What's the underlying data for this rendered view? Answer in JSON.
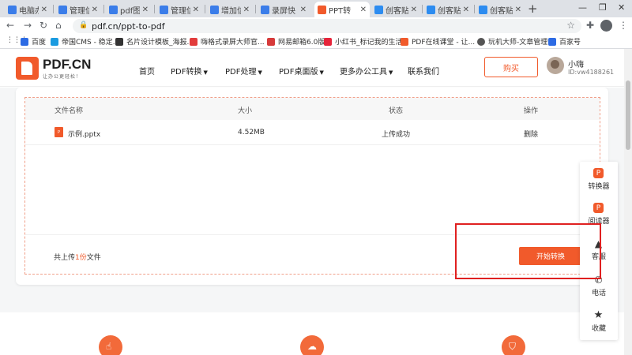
{
  "browser": {
    "tabs": [
      {
        "title": "电脑办公",
        "favicon_color": "#3b7de9",
        "active": false
      },
      {
        "title": "管理信息",
        "favicon_color": "#3b7de9",
        "active": false
      },
      {
        "title": "pdf图片",
        "favicon_color": "#3b7de9",
        "active": false
      },
      {
        "title": "管理信息",
        "favicon_color": "#3b7de9",
        "active": false
      },
      {
        "title": "增加信息",
        "favicon_color": "#3b7de9",
        "active": false
      },
      {
        "title": "录屏快",
        "favicon_color": "#3b7de9",
        "active": false
      },
      {
        "title": "PPT转",
        "favicon_color": "#f15a2b",
        "active": true
      },
      {
        "title": "创客贴",
        "favicon_color": "#2d8cf0",
        "active": false
      },
      {
        "title": "创客贴",
        "favicon_color": "#2d8cf0",
        "active": false
      },
      {
        "title": "创客贴",
        "favicon_color": "#2d8cf0",
        "active": false
      }
    ],
    "url": "pdf.cn/ppt-to-pdf",
    "bookmarks": [
      {
        "label": "百度",
        "color": "#2d6be4"
      },
      {
        "label": "帝国CMS - 稳定...",
        "color": "#1b9be0"
      },
      {
        "label": "名片设计模板_海报...",
        "color": "#333333"
      },
      {
        "label": "嗨格式录屏大师官...",
        "color": "#e23c3c"
      },
      {
        "label": "网易邮箱6.0版",
        "color": "#d63a3a"
      },
      {
        "label": "小红书_标记我的生活",
        "color": "#e6243a"
      },
      {
        "label": "PDF在线课堂 - 让...",
        "color": "#f15a2b"
      },
      {
        "label": "玩机大师-文章管理",
        "color": "#555555"
      },
      {
        "label": "百家号",
        "color": "#2d6be4"
      }
    ]
  },
  "site": {
    "logo_text": "PDF.CN",
    "logo_slogan": "让办公更轻松！",
    "brand_color": "#f15a2b",
    "nav": [
      {
        "label": "首页",
        "has_dropdown": false
      },
      {
        "label": "PDF转换",
        "has_dropdown": true
      },
      {
        "label": "PDF处理",
        "has_dropdown": true
      },
      {
        "label": "PDF桌面版",
        "has_dropdown": true
      },
      {
        "label": "更多办公工具",
        "has_dropdown": true
      },
      {
        "label": "联系我们",
        "has_dropdown": false
      }
    ],
    "buy_label": "购买",
    "user": {
      "name": "小嗨",
      "id": "ID:vw4188261"
    }
  },
  "file_table": {
    "headers": [
      "文件名称",
      "大小",
      "状态",
      "操作"
    ],
    "rows": [
      {
        "name": "示例.pptx",
        "size": "4.52MB",
        "status": "上传成功",
        "action": "删除"
      }
    ],
    "count_prefix": "共上传",
    "count_num": "1份",
    "count_suffix": "文件",
    "start_label": "开始转换"
  },
  "side_panel": [
    {
      "label": "转换器",
      "icon": "converter-icon",
      "color": "#f15a2b"
    },
    {
      "label": "阅读器",
      "icon": "reader-icon",
      "color": "#f15a2b"
    },
    {
      "label": "客服",
      "icon": "bell-icon",
      "color": "#333333"
    },
    {
      "label": "电话",
      "icon": "phone-icon",
      "color": "#333333"
    },
    {
      "label": "收藏",
      "icon": "star-icon",
      "color": "#333333"
    }
  ]
}
